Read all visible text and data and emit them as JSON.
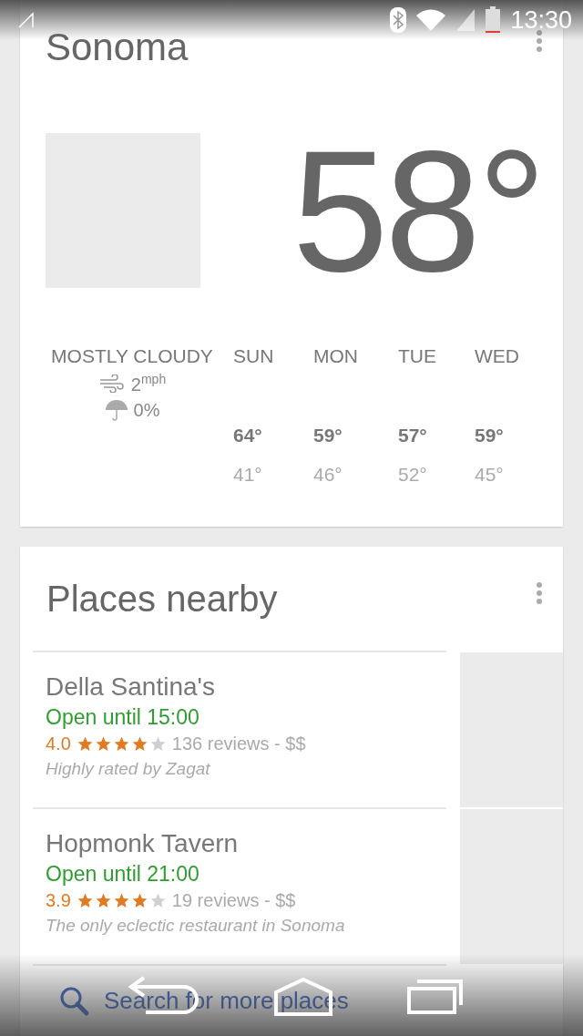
{
  "status_bar": {
    "time": "13:30"
  },
  "weather": {
    "location": "Sonoma",
    "temperature": "58°",
    "condition": "MOSTLY CLOUDY",
    "wind": "2$^{mph}$",
    "precipitation": "0%",
    "forecast": [
      {
        "day": "SUN",
        "high": "64°",
        "low": "41°"
      },
      {
        "day": "MON",
        "high": "59°",
        "low": "46°"
      },
      {
        "day": "TUE",
        "high": "57°",
        "low": "52°"
      },
      {
        "day": "WED",
        "high": "59°",
        "low": "45°"
      }
    ]
  },
  "places": {
    "title": "Places nearby",
    "items": [
      {
        "name": "Della Santina's",
        "hours": "Open until 15:00",
        "rating": "4.0",
        "stars": 4,
        "reviews": "136 reviews - $$",
        "note": "Highly rated by Zagat"
      },
      {
        "name": "Hopmonk Tavern",
        "hours": "Open until 21:00",
        "rating": "3.9",
        "stars": 4,
        "reviews": "19 reviews - $$",
        "note": "The only eclectic restaurant in Sonoma"
      }
    ],
    "search_link": "Search for more places"
  }
}
